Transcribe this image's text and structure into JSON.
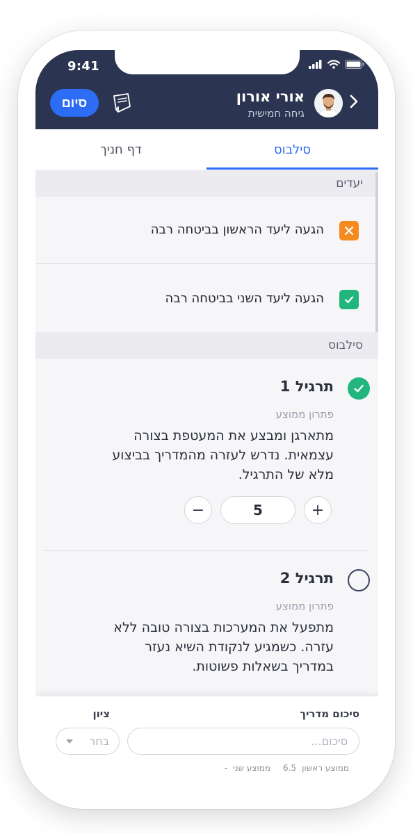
{
  "status_bar": {
    "time": "9:41"
  },
  "header": {
    "user_name": "אורי אורון",
    "user_subtitle": "גיחה חמישית",
    "finish_label": "סיום",
    "notes_icon": "notes-icon",
    "back_icon": "chevron-right-icon"
  },
  "tabs": [
    {
      "label": "סילבוס",
      "active": true
    },
    {
      "label": "דף חניך",
      "active": false
    }
  ],
  "goals_section": {
    "title": "יעדים",
    "items": [
      {
        "label": "הגעה ליעד הראשון בביטחה רבה",
        "state": "failed",
        "color": "#f58a1f"
      },
      {
        "label": "הגעה ליעד השני בביטחה רבה",
        "state": "done",
        "color": "#22b67e"
      }
    ]
  },
  "syllabus_section": {
    "title": "סילבוס",
    "exercises": [
      {
        "title": "תרגיל 1",
        "completed": true,
        "evaluation": "פתרון ממוצע",
        "description": "מתארגן ומבצע את המעטפת בצורה עצמאית. נדרש לעזרה מהמדריך בביצוע מלא של התרגיל.",
        "score": "5",
        "minus": "−",
        "plus": "+"
      },
      {
        "title": "תרגיל 2",
        "completed": false,
        "evaluation": "פתרון ממוצע",
        "description": "מתפעל את המערכות בצורה טובה ללא עזרה. כשמגיע לנקודת השיא נעזר במדריך בשאלות פשוטות."
      }
    ]
  },
  "footer": {
    "summary_label": "סיכום מדריך",
    "summary_placeholder": "סיכום...",
    "grade_label": "ציון",
    "grade_value": "בחר",
    "avg_first": "ממוצע ראשון",
    "avg_first_value": "6.5",
    "avg_second": "ממוצע שני",
    "avg_second_value": "-"
  },
  "colors": {
    "header_bg": "#2b3451",
    "accent": "#2d6cf5",
    "success": "#22b67e",
    "warning": "#f58a1f"
  }
}
